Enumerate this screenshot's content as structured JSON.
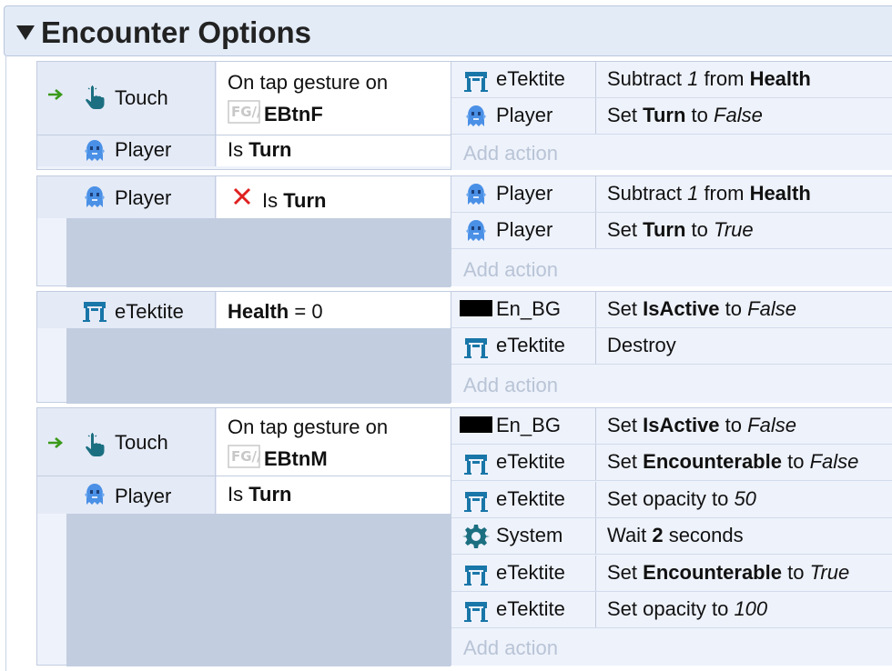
{
  "header": {
    "title": "Encounter Options"
  },
  "labels": {
    "add_action": "Add action"
  },
  "events": [
    {
      "conditions": [
        {
          "object": "Touch",
          "text_pre": "On tap gesture on",
          "target": "EBtnF",
          "has_arrow": true
        },
        {
          "object": "Player",
          "text_pre": "Is",
          "bold": "Turn"
        }
      ],
      "actions": [
        {
          "object": "eTektite",
          "pre": "Subtract",
          "italic1": "1",
          "mid": "from",
          "bold": "Health"
        },
        {
          "object": "Player",
          "pre": "Set",
          "bold": "Turn",
          "mid": "to",
          "italic2": "False"
        }
      ]
    },
    {
      "conditions": [
        {
          "object": "Player",
          "text_pre": "Is",
          "bold": "Turn",
          "inverted": true
        }
      ],
      "actions": [
        {
          "object": "Player",
          "pre": "Subtract",
          "italic1": "1",
          "mid": "from",
          "bold": "Health"
        },
        {
          "object": "Player",
          "pre": "Set",
          "bold": "Turn",
          "mid": "to",
          "italic2": "True"
        }
      ]
    },
    {
      "conditions": [
        {
          "object": "eTektite",
          "bold_first": "Health",
          "text_post": "= 0"
        }
      ],
      "actions": [
        {
          "object": "En_BG",
          "pre": "Set",
          "bold": "IsActive",
          "mid": "to",
          "italic2": "False"
        },
        {
          "object": "eTektite",
          "pre": "Destroy"
        }
      ]
    },
    {
      "conditions": [
        {
          "object": "Touch",
          "text_pre": "On tap gesture on",
          "target": "EBtnM",
          "has_arrow": true
        },
        {
          "object": "Player",
          "text_pre": "Is",
          "bold": "Turn"
        }
      ],
      "actions": [
        {
          "object": "En_BG",
          "pre": "Set",
          "bold": "IsActive",
          "mid": "to",
          "italic2": "False"
        },
        {
          "object": "eTektite",
          "pre": "Set",
          "bold": "Encounterable",
          "mid": "to",
          "italic2": "False"
        },
        {
          "object": "eTektite",
          "pre": "Set opacity to",
          "italic2": "50"
        },
        {
          "object": "System",
          "pre": "Wait",
          "bold": "2",
          "mid": "seconds"
        },
        {
          "object": "eTektite",
          "pre": "Set",
          "bold": "Encounterable",
          "mid": "to",
          "italic2": "True"
        },
        {
          "object": "eTektite",
          "pre": "Set opacity to",
          "italic2": "100"
        }
      ]
    }
  ],
  "colors": {
    "accent_blue": "#1976a8",
    "ghost_blue": "#4a90e6",
    "arrow_green": "#3a9a1a",
    "invert_red": "#e02020",
    "gear_teal": "#1b6f80"
  }
}
